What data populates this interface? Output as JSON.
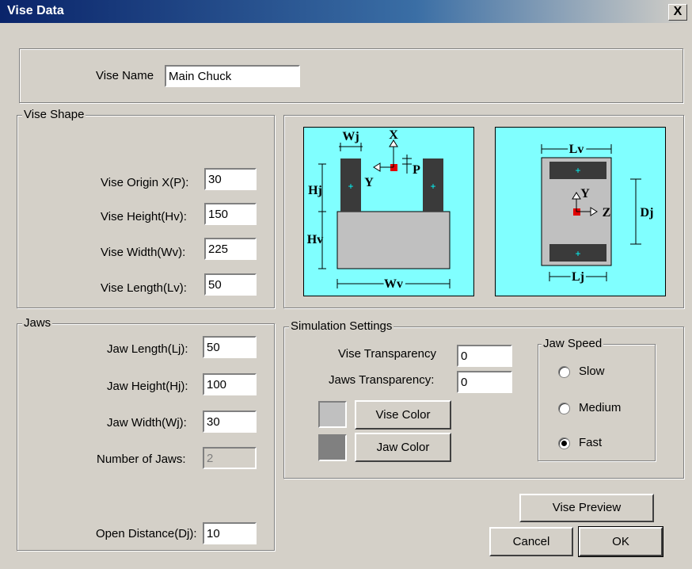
{
  "window": {
    "title": "Vise Data",
    "close": "X"
  },
  "vise_name": {
    "label": "Vise Name",
    "value": "Main Chuck"
  },
  "vise_shape": {
    "title": "Vise Shape",
    "fields": [
      {
        "label": "Vise Origin X(P):",
        "value": "30"
      },
      {
        "label": "Vise Height(Hv):",
        "value": "150"
      },
      {
        "label": "Vise Width(Wv):",
        "value": "225"
      },
      {
        "label": "Vise Length(Lv):",
        "value": "50"
      }
    ]
  },
  "diagram_front": {
    "Wj": "Wj",
    "X": "X",
    "Y": "Y",
    "P": "P",
    "Hj": "Hj",
    "Hv": "Hv",
    "Wv": "Wv"
  },
  "diagram_top": {
    "Lv": "Lv",
    "Y": "Y",
    "Z": "Z",
    "Dj": "Dj",
    "Lj": "Lj"
  },
  "jaws": {
    "title": "Jaws",
    "fields": [
      {
        "label": "Jaw Length(Lj):",
        "value": "50"
      },
      {
        "label": "Jaw Height(Hj):",
        "value": "100"
      },
      {
        "label": "Jaw Width(Wj):",
        "value": "30"
      },
      {
        "label": "Number of Jaws:",
        "value": "2"
      },
      {
        "label": "Open Distance(Dj):",
        "value": "10"
      }
    ]
  },
  "simulation": {
    "title": "Simulation Settings",
    "vise_transparency": {
      "label": "Vise Transparency",
      "value": "0"
    },
    "jaws_transparency": {
      "label": "Jaws Transparency:",
      "value": "0"
    },
    "vise_color_button": "Vise Color",
    "jaw_color_button": "Jaw Color",
    "vise_color": "#c0c0c0",
    "jaw_color": "#808080"
  },
  "jaw_speed": {
    "title": "Jaw Speed",
    "options": [
      {
        "label": "Slow",
        "selected": false
      },
      {
        "label": "Medium",
        "selected": false
      },
      {
        "label": "Fast",
        "selected": true
      }
    ]
  },
  "buttons": {
    "preview": "Vise Preview",
    "cancel": "Cancel",
    "ok": "OK"
  },
  "colors": {
    "diagram_bg": "#80ffff",
    "body_grey": "#c0c0c0",
    "jaw_dark": "#3a3a3a",
    "origin_red": "#e00000"
  }
}
